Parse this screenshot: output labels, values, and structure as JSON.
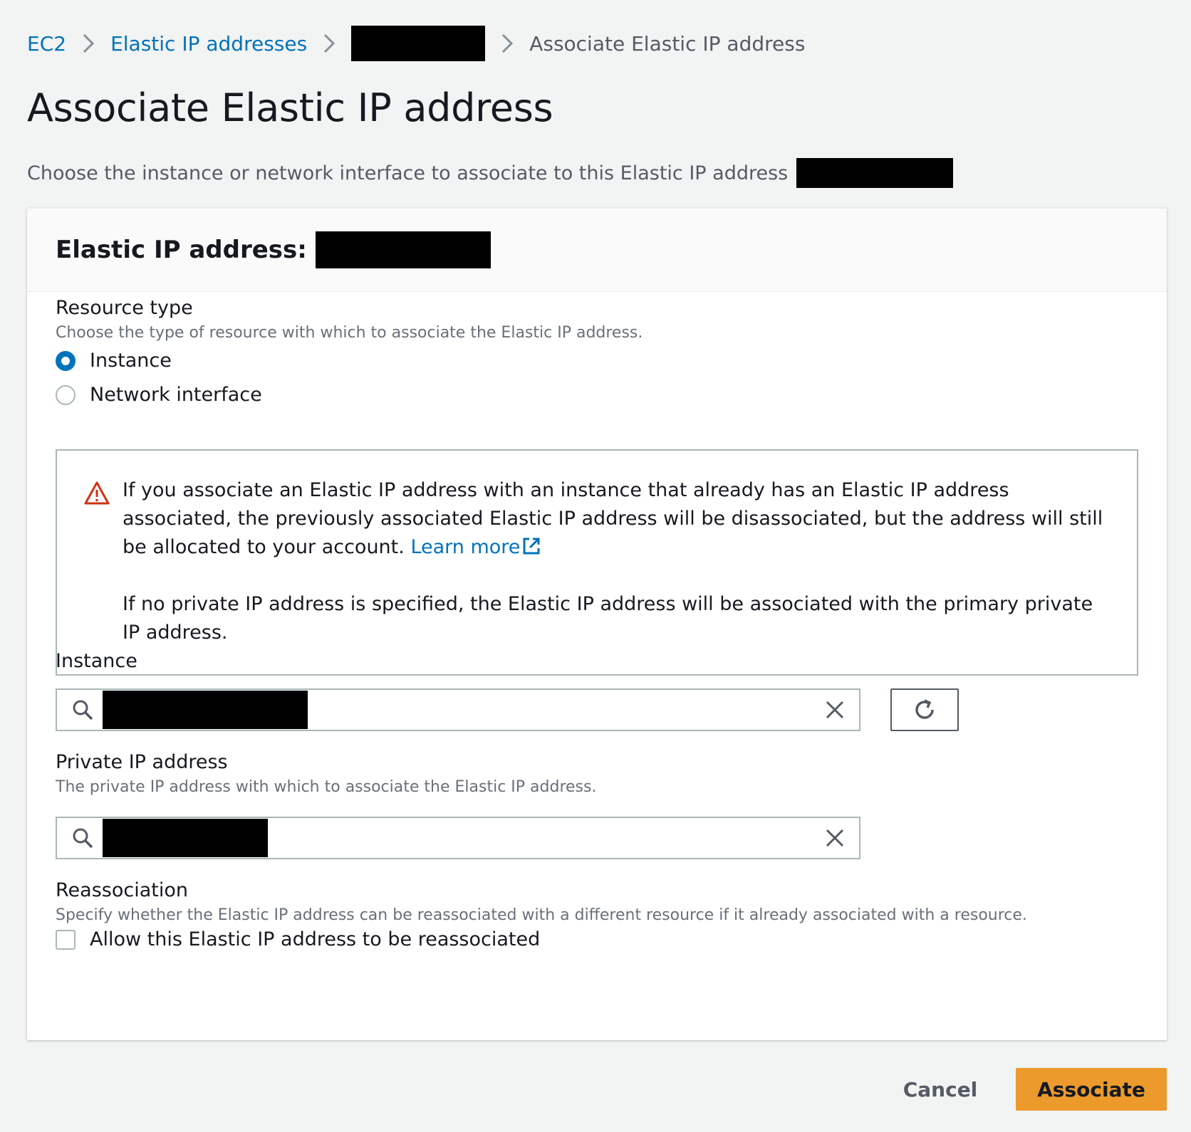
{
  "breadcrumb": {
    "items": [
      {
        "label": "EC2"
      },
      {
        "label": "Elastic IP addresses"
      }
    ],
    "current": "Associate Elastic IP address"
  },
  "page": {
    "title": "Associate Elastic IP address",
    "description": "Choose the instance or network interface to associate to this Elastic IP address"
  },
  "panel": {
    "title": "Elastic IP address:"
  },
  "resource_type": {
    "label": "Resource type",
    "description": "Choose the type of resource with which to associate the Elastic IP address.",
    "options": [
      {
        "label": "Instance",
        "selected": true
      },
      {
        "label": "Network interface",
        "selected": false
      }
    ]
  },
  "alert": {
    "paragraph1": "If you associate an Elastic IP address with an instance that already has an Elastic IP address associated, the previously associated Elastic IP address will be disassociated, but the address will still be allocated to your account.",
    "learn_more": "Learn more",
    "paragraph2": "If no private IP address is specified, the Elastic IP address will be associated with the primary private IP address.",
    "icon": "warning-icon",
    "icon_color": "#d13212"
  },
  "instance": {
    "label": "Instance"
  },
  "private_ip": {
    "label": "Private IP address",
    "description": "The private IP address with which to associate the Elastic IP address."
  },
  "reassociation": {
    "label": "Reassociation",
    "description": "Specify whether the Elastic IP address can be reassociated with a different resource if it already associated with a resource.",
    "checkbox_label": "Allow this Elastic IP address to be reassociated",
    "checked": false
  },
  "footer": {
    "cancel_label": "Cancel",
    "associate_label": "Associate"
  },
  "colors": {
    "link": "#0073bb",
    "primary_button": "#ec9a2c",
    "background": "#f2f3f3"
  }
}
